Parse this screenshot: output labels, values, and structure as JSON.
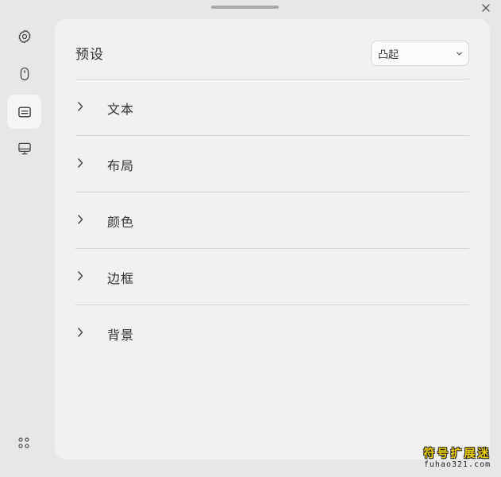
{
  "window": {
    "close_icon": "close-icon"
  },
  "sidebar": {
    "items": [
      {
        "id": "settings",
        "icon": "gear-icon",
        "active": false
      },
      {
        "id": "mouse",
        "icon": "mouse-icon",
        "active": false
      },
      {
        "id": "text-box",
        "icon": "text-box-icon",
        "active": true
      },
      {
        "id": "display",
        "icon": "monitor-icon",
        "active": false
      }
    ],
    "bottom_icon": "apps-dots-icon"
  },
  "preset": {
    "label": "预设",
    "selected": "凸起"
  },
  "sections": [
    {
      "label": "文本"
    },
    {
      "label": "布局"
    },
    {
      "label": "颜色"
    },
    {
      "label": "边框"
    },
    {
      "label": "背景"
    }
  ],
  "watermark": {
    "title": "符号扩展迷",
    "url": "fuhao321.com"
  },
  "colors": {
    "background": "#e7e7e7",
    "panel": "#f1f1f1",
    "active_nav": "#f5f5f5",
    "divider": "#d3d3d3",
    "watermark": "#f0d000"
  }
}
